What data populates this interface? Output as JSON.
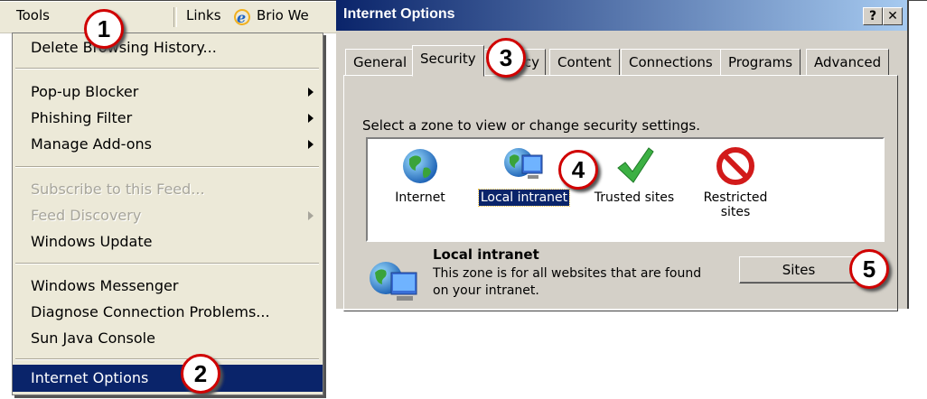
{
  "menubar": {
    "tools": "Tools",
    "links": "Links",
    "brio": "Brio We"
  },
  "menu": {
    "items": [
      {
        "label": "Delete Browsing History..."
      },
      {
        "label": "Pop-up Blocker"
      },
      {
        "label": "Phishing Filter"
      },
      {
        "label": "Manage Add-ons"
      },
      {
        "label": "Subscribe to this Feed..."
      },
      {
        "label": "Feed Discovery"
      },
      {
        "label": "Windows Update"
      },
      {
        "label": "Windows Messenger"
      },
      {
        "label": "Diagnose Connection Problems..."
      },
      {
        "label": "Sun Java Console"
      },
      {
        "label": "Internet Options"
      }
    ]
  },
  "dialog": {
    "title": "Internet Options",
    "help_btn": "?",
    "close_btn": "✕",
    "tabs": [
      "General",
      "Security",
      "Privacy",
      "Content",
      "Connections",
      "Programs",
      "Advanced"
    ],
    "zone_prompt": "Select a zone to view or change security settings.",
    "zones": [
      "Internet",
      "Local intranet",
      "Trusted sites",
      "Restricted sites"
    ],
    "zone_name": "Local intranet",
    "zone_desc": "This zone is for all websites that are found on your intranet.",
    "sites_button": "Sites"
  },
  "callouts": [
    "1",
    "2",
    "3",
    "4",
    "5"
  ],
  "colors": {
    "titlebar_start": "#0a246a",
    "titlebar_end": "#a6caf0",
    "menu_selected": "#0a246a",
    "callout_border": "#d00000"
  }
}
